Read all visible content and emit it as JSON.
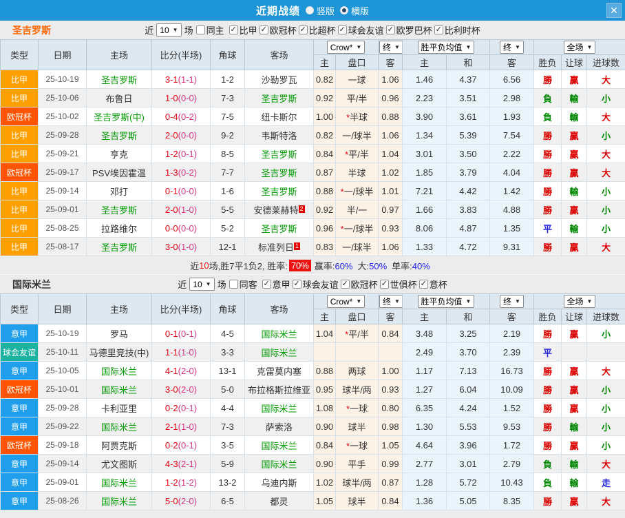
{
  "titlebar": {
    "title": "近期战绩",
    "radios": [
      {
        "label": "竖版",
        "checked": false
      },
      {
        "label": "横版",
        "checked": true
      }
    ],
    "close_icon": "✕"
  },
  "colors": {
    "titlebar_bg": "#1d95d6",
    "league_colors": {
      "比甲": "#ffa000",
      "欧冠杯": "#ff5400",
      "意甲": "#1e9eeb",
      "球会友谊": "#1ab2a0"
    },
    "outcome_colors": {
      "勝": "#dd0000",
      "負": "#008800",
      "平": "#2222dd",
      "贏": "#dd0000",
      "輸": "#008800",
      "大": "#dd0000",
      "小": "#008800",
      "走": "#2222dd"
    }
  },
  "table_header": {
    "cols": [
      "类型",
      "日期",
      "主场",
      "比分(半场)",
      "角球",
      "客场"
    ],
    "subcols": [
      "主",
      "盘口",
      "客",
      "主",
      "和",
      "客",
      "胜负",
      "让球",
      "进球数"
    ],
    "selects": {
      "bookmaker": "Crow*",
      "final1": "终",
      "avg": "胜平负均值",
      "final2": "终",
      "scope": "全场"
    }
  },
  "sections": [
    {
      "team": "圣吉罗斯",
      "team_color": "#ff6600",
      "filter": {
        "near_label": "近",
        "count": "10",
        "unit_label": "场",
        "venue": {
          "label": "同主",
          "checked": false
        },
        "leagues": [
          {
            "label": "比甲",
            "checked": true
          },
          {
            "label": "欧冠杯",
            "checked": true
          },
          {
            "label": "比超杯",
            "checked": true
          },
          {
            "label": "球会友谊",
            "checked": true
          },
          {
            "label": "欧罗巴杯",
            "checked": true
          },
          {
            "label": "比利时杯",
            "checked": true
          }
        ]
      },
      "rows": [
        {
          "type": "比甲",
          "date": "25-10-19",
          "home": "圣吉罗斯",
          "ft": "3-1",
          "ht": "(1-1)",
          "corner": "1-2",
          "away": "沙勒罗瓦",
          "sup_away": "",
          "o1": "0.82",
          "hcap": "一球",
          "o2": "1.06",
          "a1": "1.46",
          "a2": "4.37",
          "a3": "6.56",
          "res": "勝",
          "hres": "贏",
          "gres": "大"
        },
        {
          "type": "比甲",
          "date": "25-10-06",
          "home": "布鲁日",
          "ft": "1-0",
          "ht": "(0-0)",
          "corner": "7-3",
          "away": "圣吉罗斯",
          "sup_away": "",
          "o1": "0.92",
          "hcap": "平/半",
          "o2": "0.96",
          "a1": "2.23",
          "a2": "3.51",
          "a3": "2.98",
          "res": "負",
          "hres": "輸",
          "gres": "小"
        },
        {
          "type": "欧冠杯",
          "date": "25-10-02",
          "home": "圣吉罗斯(中)",
          "ft": "0-4",
          "ht": "(0-2)",
          "corner": "7-5",
          "away": "纽卡斯尔",
          "sup_away": "",
          "o1": "1.00",
          "hcap": "*半球",
          "o2": "0.88",
          "a1": "3.90",
          "a2": "3.61",
          "a3": "1.93",
          "res": "負",
          "hres": "輸",
          "gres": "大"
        },
        {
          "type": "比甲",
          "date": "25-09-28",
          "home": "圣吉罗斯",
          "ft": "2-0",
          "ht": "(0-0)",
          "corner": "9-2",
          "away": "韦斯特洛",
          "sup_away": "",
          "o1": "0.82",
          "hcap": "一/球半",
          "o2": "1.06",
          "a1": "1.34",
          "a2": "5.39",
          "a3": "7.54",
          "res": "勝",
          "hres": "贏",
          "gres": "小"
        },
        {
          "type": "比甲",
          "date": "25-09-21",
          "home": "亨克",
          "ft": "1-2",
          "ht": "(0-1)",
          "corner": "8-5",
          "away": "圣吉罗斯",
          "sup_away": "",
          "o1": "0.84",
          "hcap": "*平/半",
          "o2": "1.04",
          "a1": "3.01",
          "a2": "3.50",
          "a3": "2.22",
          "res": "勝",
          "hres": "贏",
          "gres": "大"
        },
        {
          "type": "欧冠杯",
          "date": "25-09-17",
          "home": "PSV埃因霍温",
          "ft": "1-3",
          "ht": "(0-2)",
          "corner": "7-7",
          "away": "圣吉罗斯",
          "sup_away": "",
          "o1": "0.87",
          "hcap": "半球",
          "o2": "1.02",
          "a1": "1.85",
          "a2": "3.79",
          "a3": "4.04",
          "res": "勝",
          "hres": "贏",
          "gres": "大"
        },
        {
          "type": "比甲",
          "date": "25-09-14",
          "home": "邓打",
          "ft": "0-1",
          "ht": "(0-0)",
          "corner": "1-6",
          "away": "圣吉罗斯",
          "sup_away": "",
          "o1": "0.88",
          "hcap": "*一/球半",
          "o2": "1.01",
          "a1": "7.21",
          "a2": "4.42",
          "a3": "1.42",
          "res": "勝",
          "hres": "輸",
          "gres": "小"
        },
        {
          "type": "比甲",
          "date": "25-09-01",
          "home": "圣吉罗斯",
          "ft": "2-0",
          "ht": "(1-0)",
          "corner": "5-5",
          "away": "安德莱赫特",
          "sup_away": "2",
          "o1": "0.92",
          "hcap": "半/一",
          "o2": "0.97",
          "a1": "1.66",
          "a2": "3.83",
          "a3": "4.88",
          "res": "勝",
          "hres": "贏",
          "gres": "小"
        },
        {
          "type": "比甲",
          "date": "25-08-25",
          "home": "拉路维尔",
          "ft": "0-0",
          "ht": "(0-0)",
          "corner": "5-2",
          "away": "圣吉罗斯",
          "sup_away": "",
          "o1": "0.96",
          "hcap": "*一/球半",
          "o2": "0.93",
          "a1": "8.06",
          "a2": "4.87",
          "a3": "1.35",
          "res": "平",
          "hres": "輸",
          "gres": "小"
        },
        {
          "type": "比甲",
          "date": "25-08-17",
          "home": "圣吉罗斯",
          "ft": "3-0",
          "ht": "(1-0)",
          "corner": "12-1",
          "away": "标准列日",
          "sup_away": "1",
          "o1": "0.83",
          "hcap": "一/球半",
          "o2": "1.06",
          "a1": "1.33",
          "a2": "4.72",
          "a3": "9.31",
          "res": "勝",
          "hres": "贏",
          "gres": "大"
        }
      ],
      "summary": {
        "pre": "近",
        "count": "10",
        "post": "场,胜7平1负2, 胜率:",
        "rate": "70%",
        "stats": [
          {
            "label": "赢率:",
            "value": "60%"
          },
          {
            "label": "大:",
            "value": "50%"
          },
          {
            "label": "单率:",
            "value": "40%"
          }
        ]
      }
    },
    {
      "team": "国际米兰",
      "team_color": "#333333",
      "filter": {
        "near_label": "近",
        "count": "10",
        "unit_label": "场",
        "venue": {
          "label": "同客",
          "checked": false
        },
        "leagues": [
          {
            "label": "意甲",
            "checked": true
          },
          {
            "label": "球会友谊",
            "checked": true
          },
          {
            "label": "欧冠杯",
            "checked": true
          },
          {
            "label": "世俱杯",
            "checked": true
          },
          {
            "label": "意杯",
            "checked": true
          }
        ]
      },
      "rows": [
        {
          "type": "意甲",
          "date": "25-10-19",
          "home": "罗马",
          "ft": "0-1",
          "ht": "(0-1)",
          "corner": "4-5",
          "away": "国际米兰",
          "sup_away": "",
          "o1": "1.04",
          "hcap": "*平/半",
          "o2": "0.84",
          "a1": "3.48",
          "a2": "3.25",
          "a3": "2.19",
          "res": "勝",
          "hres": "贏",
          "gres": "小"
        },
        {
          "type": "球会友谊",
          "date": "25-10-11",
          "home": "马德里竞技(中)",
          "ft": "1-1",
          "ht": "(1-0)",
          "corner": "3-3",
          "away": "国际米兰",
          "sup_away": "",
          "o1": "",
          "hcap": "",
          "o2": "",
          "a1": "2.49",
          "a2": "3.70",
          "a3": "2.39",
          "res": "平",
          "hres": "",
          "gres": ""
        },
        {
          "type": "意甲",
          "date": "25-10-05",
          "home": "国际米兰",
          "ft": "4-1",
          "ht": "(2-0)",
          "corner": "13-1",
          "away": "克雷莫内塞",
          "sup_away": "",
          "o1": "0.88",
          "hcap": "两球",
          "o2": "1.00",
          "a1": "1.17",
          "a2": "7.13",
          "a3": "16.73",
          "res": "勝",
          "hres": "贏",
          "gres": "大"
        },
        {
          "type": "欧冠杯",
          "date": "25-10-01",
          "home": "国际米兰",
          "ft": "3-0",
          "ht": "(2-0)",
          "corner": "5-0",
          "away": "布拉格斯拉维亚",
          "sup_away": "",
          "o1": "0.95",
          "hcap": "球半/两",
          "o2": "0.93",
          "a1": "1.27",
          "a2": "6.04",
          "a3": "10.09",
          "res": "勝",
          "hres": "贏",
          "gres": "小"
        },
        {
          "type": "意甲",
          "date": "25-09-28",
          "home": "卡利亚里",
          "ft": "0-2",
          "ht": "(0-1)",
          "corner": "4-4",
          "away": "国际米兰",
          "sup_away": "",
          "o1": "1.08",
          "hcap": "*一球",
          "o2": "0.80",
          "a1": "6.35",
          "a2": "4.24",
          "a3": "1.52",
          "res": "勝",
          "hres": "贏",
          "gres": "小"
        },
        {
          "type": "意甲",
          "date": "25-09-22",
          "home": "国际米兰",
          "ft": "2-1",
          "ht": "(1-0)",
          "corner": "7-3",
          "away": "萨索洛",
          "sup_away": "",
          "o1": "0.90",
          "hcap": "球半",
          "o2": "0.98",
          "a1": "1.30",
          "a2": "5.53",
          "a3": "9.53",
          "res": "勝",
          "hres": "輸",
          "gres": "小"
        },
        {
          "type": "欧冠杯",
          "date": "25-09-18",
          "home": "阿贾克斯",
          "ft": "0-2",
          "ht": "(0-1)",
          "corner": "3-5",
          "away": "国际米兰",
          "sup_away": "",
          "o1": "0.84",
          "hcap": "*一球",
          "o2": "1.05",
          "a1": "4.64",
          "a2": "3.96",
          "a3": "1.72",
          "res": "勝",
          "hres": "贏",
          "gres": "小"
        },
        {
          "type": "意甲",
          "date": "25-09-14",
          "home": "尤文图斯",
          "ft": "4-3",
          "ht": "(2-1)",
          "corner": "5-9",
          "away": "国际米兰",
          "sup_away": "",
          "o1": "0.90",
          "hcap": "平手",
          "o2": "0.99",
          "a1": "2.77",
          "a2": "3.01",
          "a3": "2.79",
          "res": "負",
          "hres": "輸",
          "gres": "大"
        },
        {
          "type": "意甲",
          "date": "25-09-01",
          "home": "国际米兰",
          "ft": "1-2",
          "ht": "(1-2)",
          "corner": "13-2",
          "away": "乌迪内斯",
          "sup_away": "",
          "o1": "1.02",
          "hcap": "球半/两",
          "o2": "0.87",
          "a1": "1.28",
          "a2": "5.72",
          "a3": "10.43",
          "res": "負",
          "hres": "輸",
          "gres": "走"
        },
        {
          "type": "意甲",
          "date": "25-08-26",
          "home": "国际米兰",
          "ft": "5-0",
          "ht": "(2-0)",
          "corner": "6-5",
          "away": "都灵",
          "sup_away": "",
          "o1": "1.05",
          "hcap": "球半",
          "o2": "0.84",
          "a1": "1.36",
          "a2": "5.05",
          "a3": "8.35",
          "res": "勝",
          "hres": "贏",
          "gres": "大"
        }
      ],
      "summary": null
    }
  ]
}
